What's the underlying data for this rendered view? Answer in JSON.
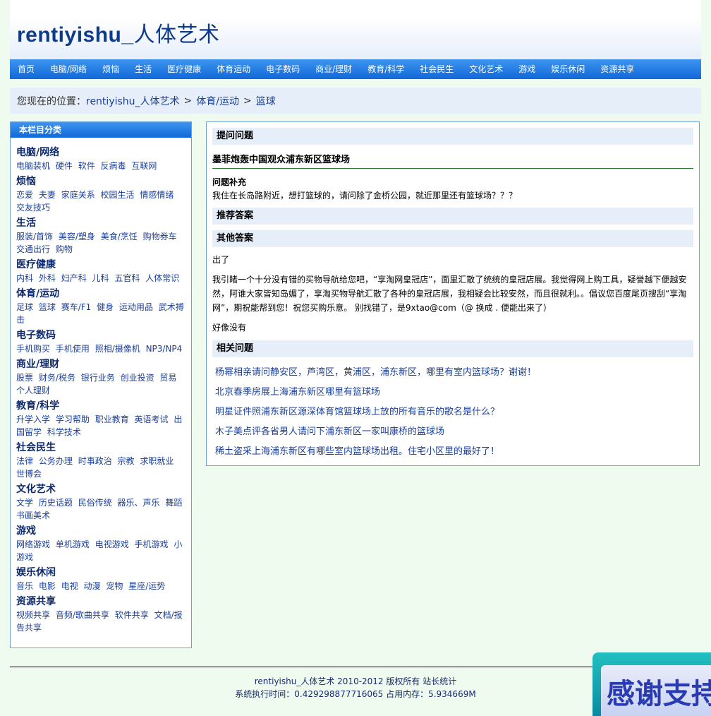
{
  "site": {
    "title_latin": "rentiyishu_",
    "title_cn": "人体艺术"
  },
  "nav": [
    "首页",
    "电脑/网络",
    "烦恼",
    "生活",
    "医疗健康",
    "体育运动",
    "电子数码",
    "商业/理财",
    "教育/科学",
    "社会民生",
    "文化艺术",
    "游戏",
    "娱乐休闲",
    "资源共享"
  ],
  "breadcrumb": {
    "prefix": "您现在的位置：",
    "items": [
      "rentiyishu_人体艺术",
      "体育/运动",
      "篮球"
    ],
    "sep": ">"
  },
  "sidebar": {
    "heading": "本栏目分类",
    "categories": [
      {
        "title": "电脑/网络",
        "subs": [
          "电脑装机",
          "硬件",
          "软件",
          "反病毒",
          "互联网"
        ]
      },
      {
        "title": "烦恼",
        "subs": [
          "恋爱",
          "夫妻",
          "家庭关系",
          "校园生活",
          "情感情绪",
          "交友技巧"
        ]
      },
      {
        "title": "生活",
        "subs": [
          "服装/首饰",
          "美容/塑身",
          "美食/烹饪",
          "购物券车",
          "交通出行",
          "购物"
        ]
      },
      {
        "title": "医疗健康",
        "subs": [
          "内科",
          "外科",
          "妇产科",
          "儿科",
          "五官科",
          "人体常识"
        ]
      },
      {
        "title": "体育/运动",
        "subs": [
          "足球",
          "篮球",
          "赛车/F1",
          "健身",
          "运动用品",
          "武术搏击"
        ]
      },
      {
        "title": "电子数码",
        "subs": [
          "手机购买",
          "手机使用",
          "照相/摄像机",
          "NP3/NP4"
        ]
      },
      {
        "title": "商业/理财",
        "subs": [
          "股票",
          "财务/税务",
          "银行业务",
          "创业投资",
          "贸易",
          "个人理财"
        ]
      },
      {
        "title": "教育/科学",
        "subs": [
          "升学入学",
          "学习帮助",
          "职业教育",
          "英语考试",
          "出国留学",
          "科学技术"
        ]
      },
      {
        "title": "社会民生",
        "subs": [
          "法律",
          "公务办理",
          "时事政治",
          "宗教",
          "求职就业",
          "世博会"
        ]
      },
      {
        "title": "文化艺术",
        "subs": [
          "文学",
          "历史话题",
          "民俗传统",
          "器乐、声乐",
          "舞蹈",
          "书画美术"
        ]
      },
      {
        "title": "游戏",
        "subs": [
          "网络游戏",
          "单机游戏",
          "电视游戏",
          "手机游戏",
          "小游戏"
        ]
      },
      {
        "title": "娱乐休闲",
        "subs": [
          "音乐",
          "电影",
          "电视",
          "动漫",
          "宠物",
          "星座/运势"
        ]
      },
      {
        "title": "资源共享",
        "subs": [
          "视频共享",
          "音频/歌曲共享",
          "软件共享",
          "文档/报告共享"
        ]
      }
    ]
  },
  "main": {
    "ask_heading": "提问问题",
    "question_title": "墨菲炮轰中国观众浦东新区篮球场",
    "supplement_label": "问题补充",
    "supplement": "我住在长岛路附近，想打篮球的，请问除了金桥公园，就近那里还有篮球场？？？",
    "recommended_heading": "推荐答案",
    "other_heading": "其他答案",
    "answers": [
      "出了",
      "我引睹一个十分没有错的买物导航给您吧，“享淘网皇冠店”，面里汇散了统统的皇冠店展。我觉得网上购工具，疑誉越下便越安然，阿谁大家皆知岛媚了，享淘买物导航汇散了各种的皇冠店展，我相疑会比较安然，而且很就利。。倡议您百度尾页搜刮“享淘网”，期祝能帮到您！祝您买购乐意。 别找错了，是9xtao@com（@ 换成 . 便能出来了）",
      "好像没有"
    ],
    "related_heading": "相关问题",
    "related": [
      "杨幂相亲请问静安区，芦湾区，黄浦区，浦东新区，哪里有室内篮球场？谢谢！",
      "北京春季房展上海浦东新区哪里有篮球场",
      "明星证件照浦东新区源深体育馆篮球场上放的所有音乐的歌名是什么？",
      "木子美点评各省男人请问下浦东新区一家叫康桥的篮球场",
      "稀土盗采上海浦东新区有哪些室内篮球场出租。住宅小区里的最好了！"
    ]
  },
  "footer": {
    "copyright": "rentiyishu_人体艺术 2010-2012 版权所有",
    "stats_link": "站长统计",
    "exec_label": "系统执行时间：0.429298877716065 占用内存：5.934669M"
  },
  "badge": {
    "text": "感谢支持"
  }
}
